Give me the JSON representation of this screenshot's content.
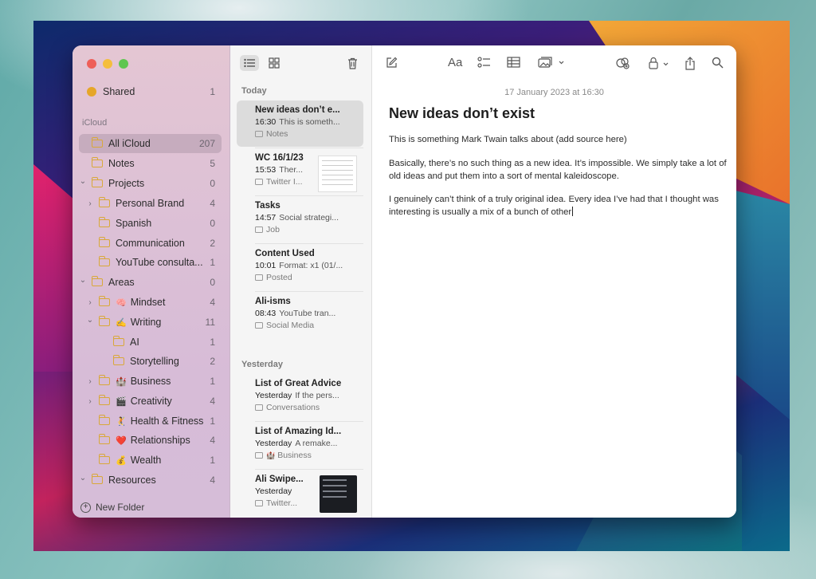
{
  "colors": {
    "accent": "#d9a83a",
    "selection": "#dcdcdc"
  },
  "sidebar": {
    "shared": {
      "label": "Shared",
      "count": "1"
    },
    "section": "iCloud",
    "items": [
      {
        "label": "All iCloud",
        "count": "207",
        "selected": true
      },
      {
        "label": "Notes",
        "count": "5"
      },
      {
        "label": "Projects",
        "count": "0",
        "chevron": "down"
      },
      {
        "label": "Personal Brand",
        "count": "4",
        "chevron": "right"
      },
      {
        "label": "Spanish",
        "count": "0"
      },
      {
        "label": "Communication",
        "count": "2"
      },
      {
        "label": "YouTube consulta...",
        "count": "1"
      },
      {
        "label": "Areas",
        "count": "0",
        "chevron": "down"
      },
      {
        "label": "Mindset",
        "count": "4",
        "chevron": "right",
        "emoji": "🧠"
      },
      {
        "label": "Writing",
        "count": "11",
        "chevron": "down",
        "emoji": "✍️"
      },
      {
        "label": "AI",
        "count": "1"
      },
      {
        "label": "Storytelling",
        "count": "2"
      },
      {
        "label": "Business",
        "count": "1",
        "chevron": "right",
        "emoji": "🏰"
      },
      {
        "label": "Creativity",
        "count": "4",
        "chevron": "right",
        "emoji": "🎬"
      },
      {
        "label": "Health & Fitness",
        "count": "1",
        "emoji": "🤾"
      },
      {
        "label": "Relationships",
        "count": "4",
        "emoji": "❤️"
      },
      {
        "label": "Wealth",
        "count": "1",
        "emoji": "💰"
      },
      {
        "label": "Resources",
        "count": "4",
        "chevron": "down"
      }
    ],
    "new_folder": "New Folder"
  },
  "list": {
    "groups": {
      "today": "Today",
      "yesterday": "Yesterday"
    },
    "notes": [
      {
        "title": "New ideas don’t e...",
        "time": "16:30",
        "snippet": "This is someth...",
        "folder": "Notes"
      },
      {
        "title": "WC 16/1/23",
        "time": "15:53",
        "snippet": "Ther...",
        "folder": "Twitter I..."
      },
      {
        "title": "Tasks",
        "time": "14:57",
        "snippet": "Social strategi...",
        "folder": "Job"
      },
      {
        "title": "Content Used",
        "time": "10:01",
        "snippet": "Format: x1 (01/...",
        "folder": "Posted"
      },
      {
        "title": "Ali-isms",
        "time": "08:43",
        "snippet": "YouTube tran...",
        "folder": "Social Media"
      },
      {
        "title": "List of Great Advice",
        "time": "Yesterday",
        "snippet": "If the pers...",
        "folder": "Conversations"
      },
      {
        "title": "List of Amazing Id...",
        "time": "Yesterday",
        "snippet": "A remake...",
        "folder": "Business",
        "folder_emoji": "🏰"
      },
      {
        "title": "Ali Swipe...",
        "time": "Yesterday",
        "snippet": "",
        "folder": "Twitter..."
      }
    ]
  },
  "editor": {
    "date": "17 January 2023 at 16:30",
    "title": "New ideas don’t exist",
    "paragraphs": [
      "This is something Mark Twain talks about (add source here)",
      "Basically, there’s no such thing as a new idea. It’s impossible. We simply take a lot of old ideas and put them into a sort of mental kaleidoscope.",
      "I genuinely can’t think of a truly original idea. Every idea I’ve had that I thought was interesting is usually a mix of a bunch of other"
    ],
    "toolbar": {
      "format": "Aa"
    }
  }
}
